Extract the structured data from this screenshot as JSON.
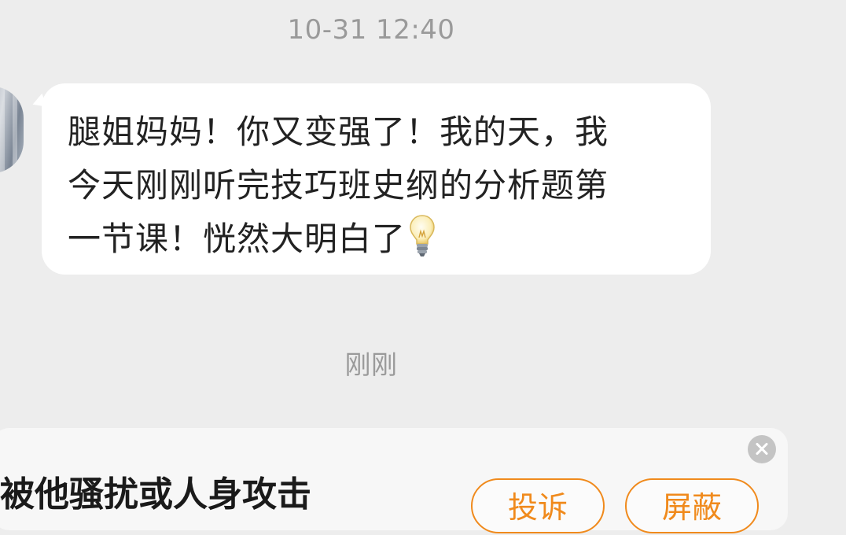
{
  "chat": {
    "timestamp_first": "10-31 12:40",
    "message_text": "腿姐妈妈！你又变强了！我的天，我\n今天刚刚听完技巧班史纲的分析题第\n一节课！恍然大明白了",
    "message_emoji": "light-bulb",
    "timestamp_second": "刚刚"
  },
  "notice": {
    "text": "被他骚扰或人身攻击",
    "report_label": "投诉",
    "block_label": "屏蔽",
    "accent_color": "#f08a1c"
  },
  "colors": {
    "background": "#ededed",
    "bubble": "#ffffff",
    "timestamp": "#9a9a9a"
  }
}
